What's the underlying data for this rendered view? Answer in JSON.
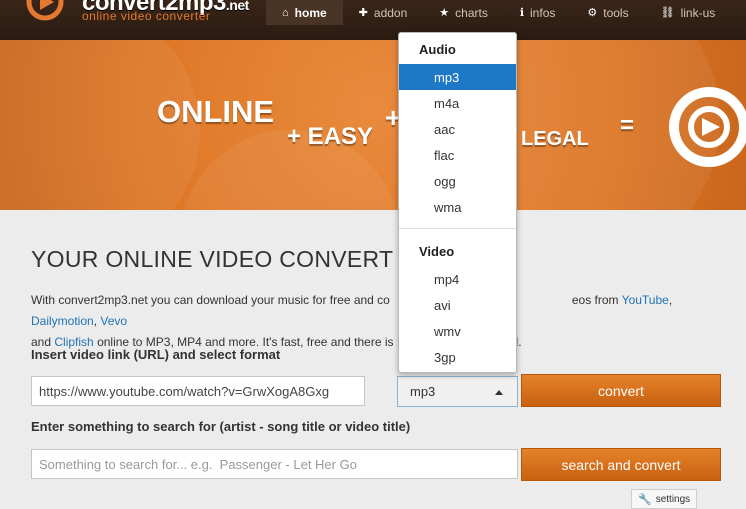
{
  "logo": {
    "title": "convert2mp3",
    "title_suffix": ".net",
    "subtitle": "online video converter"
  },
  "nav": {
    "items": [
      {
        "label": "home",
        "icon": "home-icon"
      },
      {
        "label": "addon",
        "icon": "puzzle-icon"
      },
      {
        "label": "charts",
        "icon": "star-icon"
      },
      {
        "label": "infos",
        "icon": "info-icon"
      },
      {
        "label": "tools",
        "icon": "tools-icon"
      },
      {
        "label": "link-us",
        "icon": "link-icon"
      }
    ],
    "active": "home"
  },
  "banner": {
    "w1": "ONLINE",
    "w2": "+ EASY",
    "w3": "+",
    "w4": "LEGAL",
    "w5": "="
  },
  "main": {
    "heading": "YOUR ONLINE VIDEO CONVERT",
    "para": {
      "p1": "With convert2mp3.net you can download your music for free and co",
      "p2": "eos from",
      "link_youtube": "YouTube",
      "c1": ",",
      "link_dailymotion": "Dailymotion",
      "c2": ",",
      "link_vevo": "Vevo",
      "p3": "and",
      "link_clipfish": "Clipfish",
      "p4": "online to MP3, MP4 and more. It's fast, free and there is",
      "p5": "d."
    },
    "url_label": "Insert video link (URL) and select format",
    "url_value": "https://www.youtube.com/watch?v=GrwXogA8Gxg",
    "format_selected": "mp3",
    "convert_label": "convert",
    "search_label": "Enter something to search for (artist - song title or video title)",
    "search_placeholder": "Something to search for... e.g.  Passenger - Let Her Go",
    "search_button": "search and convert",
    "settings_label": "settings"
  },
  "dropdown": {
    "audio_label": "Audio",
    "audio": [
      "mp3",
      "m4a",
      "aac",
      "flac",
      "ogg",
      "wma"
    ],
    "video_label": "Video",
    "video": [
      "mp4",
      "avi",
      "wmv",
      "3gp"
    ],
    "highlighted": "mp3"
  },
  "colors": {
    "accent": "#de7727",
    "link": "#1f74b8",
    "highlight": "#1e78c8",
    "topbar": "#2f1e13"
  }
}
